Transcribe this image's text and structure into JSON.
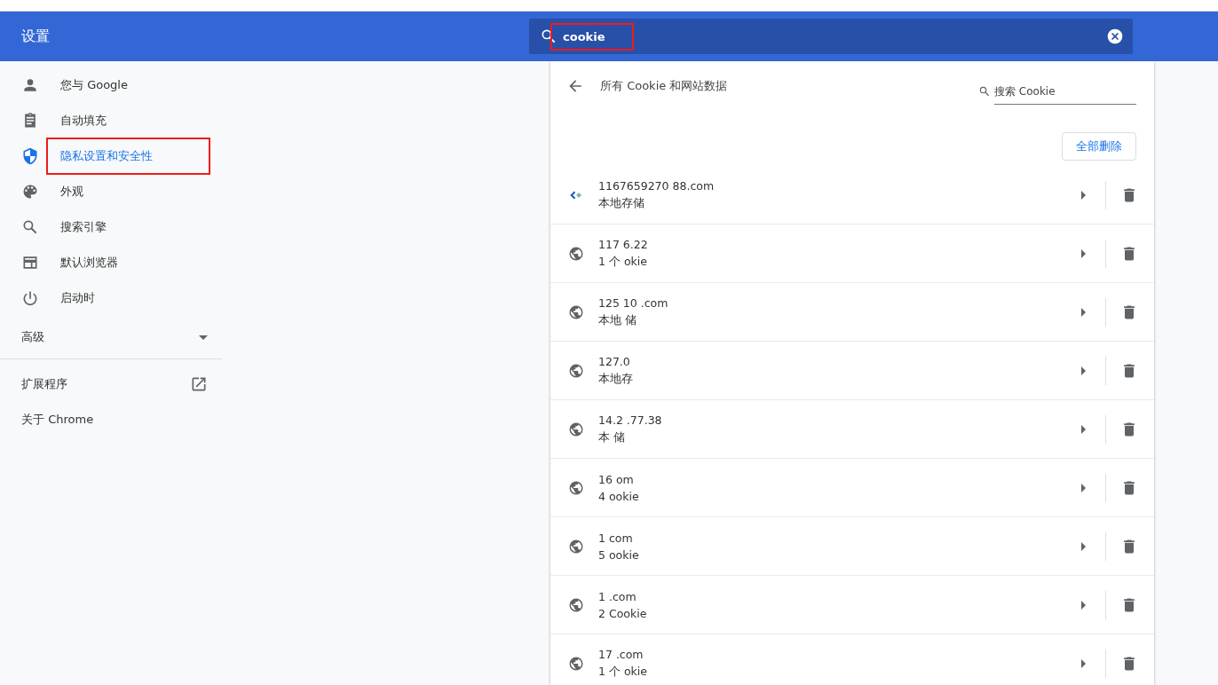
{
  "header": {
    "title": "设置",
    "search": {
      "value": "cookie",
      "annotated": true
    }
  },
  "sidebar": {
    "items": [
      {
        "label": "您与 Google",
        "kind": "person",
        "selected": false,
        "annotated": false
      },
      {
        "label": "自动填充",
        "kind": "clipboard",
        "selected": false,
        "annotated": false
      },
      {
        "label": "隐私设置和安全性",
        "kind": "shield",
        "selected": true,
        "annotated": true
      },
      {
        "label": "外观",
        "kind": "palette",
        "selected": false,
        "annotated": false
      },
      {
        "label": "搜索引擎",
        "kind": "search",
        "selected": false,
        "annotated": false
      },
      {
        "label": "默认浏览器",
        "kind": "browser",
        "selected": false,
        "annotated": false
      },
      {
        "label": "启动时",
        "kind": "power",
        "selected": false,
        "annotated": false
      }
    ],
    "advanced": {
      "label": "高级",
      "expanded": false
    },
    "links": [
      {
        "label": "扩展程序",
        "external": true
      },
      {
        "label": "关于 Chrome",
        "external": false
      }
    ]
  },
  "panel": {
    "title": "所有 Cookie 和网站数据",
    "search_placeholder": "搜索 Cookie",
    "remove_all": "全部删除",
    "sites": [
      {
        "name": "1167659270 88.com",
        "detail": "本地存储",
        "kind": "favicon"
      },
      {
        "name": "117 6.22",
        "detail": "1 个 okie",
        "kind": "globe"
      },
      {
        "name": "125 10 .com",
        "detail": "本地 储",
        "kind": "globe"
      },
      {
        "name": "127.0",
        "detail": "本地存",
        "kind": "globe"
      },
      {
        "name": "14.2 .77.38",
        "detail": "本 储",
        "kind": "globe"
      },
      {
        "name": "16 om",
        "detail": "4 ookie",
        "kind": "globe"
      },
      {
        "name": "1 com",
        "detail": "5 ookie",
        "kind": "globe"
      },
      {
        "name": "1 .com",
        "detail": "2 Cookie",
        "kind": "globe"
      },
      {
        "name": "17 .com",
        "detail": "1 个 okie",
        "kind": "globe"
      }
    ]
  }
}
